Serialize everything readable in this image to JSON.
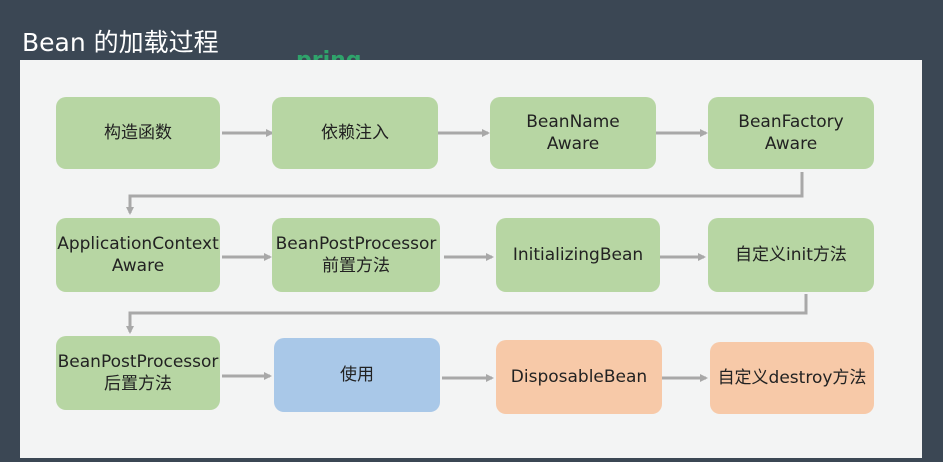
{
  "title": "Bean 的加载过程",
  "partial_text": "pring",
  "colors": {
    "background": "#3b4754",
    "panel": "#f3f4f4",
    "green": "#b7d6a3",
    "blue": "#a9c8e8",
    "peach": "#f7c9a8",
    "arrow": "#a8a8a8"
  },
  "steps": [
    {
      "label": "构造函数",
      "color": "green"
    },
    {
      "label": "依赖注入",
      "color": "green"
    },
    {
      "label": "BeanName\nAware",
      "color": "green"
    },
    {
      "label": "BeanFactory\nAware",
      "color": "green"
    },
    {
      "label": "ApplicationContext\nAware",
      "color": "green"
    },
    {
      "label": "BeanPostProcessor\n前置方法",
      "color": "green"
    },
    {
      "label": "InitializingBean",
      "color": "green"
    },
    {
      "label": "自定义init方法",
      "color": "green"
    },
    {
      "label": "BeanPostProcessor\n后置方法",
      "color": "green"
    },
    {
      "label": "使用",
      "color": "blue"
    },
    {
      "label": "DisposableBean",
      "color": "peach"
    },
    {
      "label": "自定义destroy方法",
      "color": "peach"
    }
  ]
}
